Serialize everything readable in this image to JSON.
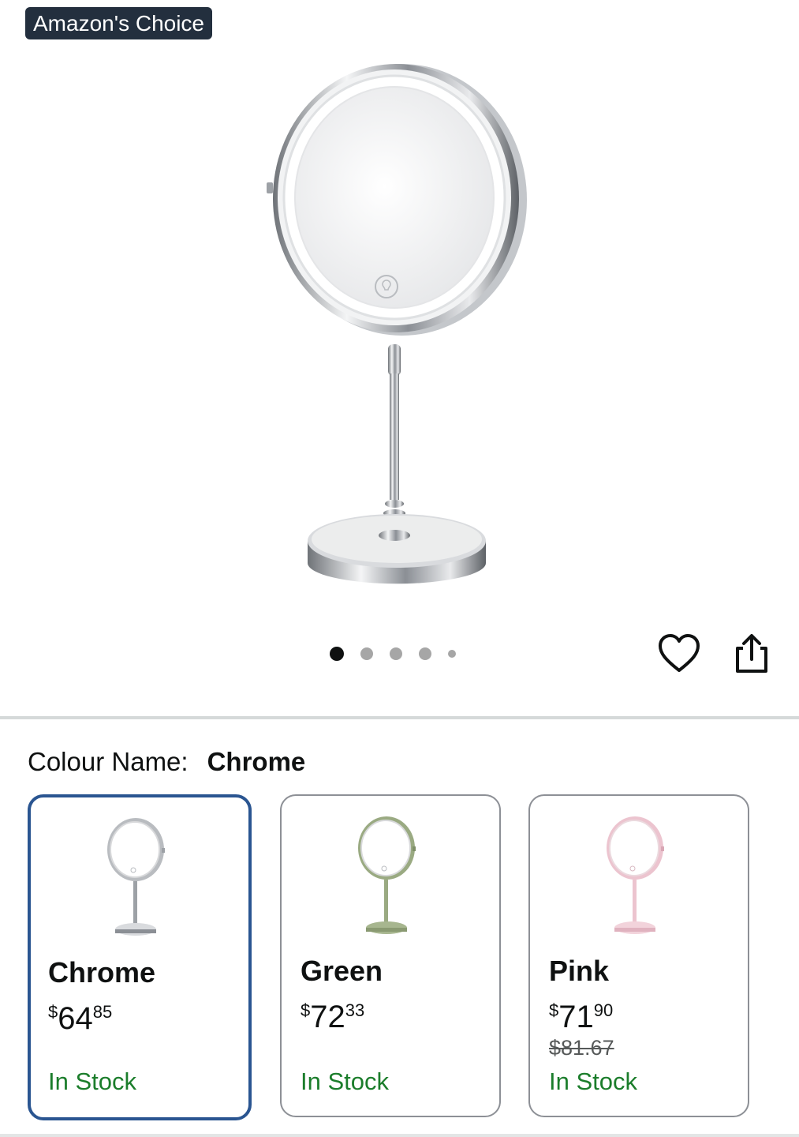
{
  "badge": {
    "text": "Amazon's Choice"
  },
  "gallery": {
    "image_count": 5,
    "active_index": 0
  },
  "icons": {
    "favorite": "heart-outline-icon",
    "share": "share-icon"
  },
  "colour": {
    "label": "Colour Name:",
    "selected": "Chrome"
  },
  "variants": [
    {
      "name": "Chrome",
      "price_symbol": "$",
      "price_whole": "64",
      "price_fraction": "85",
      "list_price": "",
      "stock": "In Stock",
      "color": "#c9cbcf",
      "selected": true
    },
    {
      "name": "Green",
      "price_symbol": "$",
      "price_whole": "72",
      "price_fraction": "33",
      "list_price": "",
      "stock": "In Stock",
      "color": "#9aaa82",
      "selected": false
    },
    {
      "name": "Pink",
      "price_symbol": "$",
      "price_whole": "71",
      "price_fraction": "90",
      "list_price": "$81.67",
      "stock": "In Stock",
      "color": "#ecc4cf",
      "selected": false
    }
  ],
  "colors": {
    "badge_bg": "#232f3e",
    "selected_border": "#2a5591",
    "in_stock": "#1b7d2b"
  }
}
